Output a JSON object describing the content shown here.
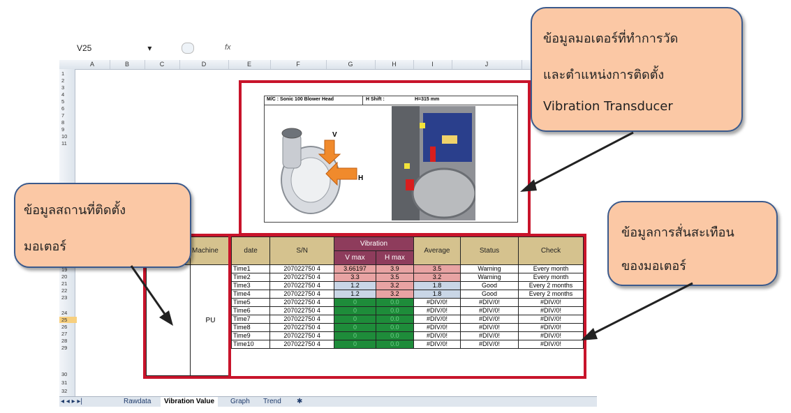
{
  "excel": {
    "name_box": "V25",
    "fx": "fx",
    "columns": [
      "A",
      "B",
      "C",
      "D",
      "E",
      "F",
      "G",
      "H",
      "I",
      "J"
    ],
    "rows": [
      "1",
      "2",
      "3",
      "4",
      "5",
      "6",
      "7",
      "8",
      "9",
      "10",
      "11",
      "19",
      "20",
      "21",
      "22",
      "23",
      "24",
      "25",
      "26",
      "27",
      "28",
      "29",
      "30",
      "31",
      "32"
    ],
    "selected_row": "25",
    "tabs": {
      "nav": "◂ ◂ ▸ ▸|",
      "rawdata": "Rawdata",
      "vibration_value": "Vibration Value",
      "graph": "Graph",
      "trend": "Trend"
    }
  },
  "picture": {
    "machine_label": "M/C : Sonic 100 Blower Head",
    "shift_label": "H Shift :",
    "shift_value": "H=315 mm",
    "v_marker": "V",
    "h_marker": "H"
  },
  "location_table": {
    "headers": [
      "Machine"
    ],
    "machine": "PU"
  },
  "vibration_table": {
    "headers": {
      "date": "date",
      "sn": "S/N",
      "vibration": "Vibration",
      "vmax": "V max",
      "hmax": "H max",
      "average": "Average",
      "status": "Status",
      "check": "Check"
    },
    "rows": [
      {
        "date": "Time1",
        "sn": "207022750 4",
        "v": "3.66197",
        "h": "3.9",
        "avg": "3.5",
        "status": "Warning",
        "check": "Every month"
      },
      {
        "date": "Time2",
        "sn": "207022750 4",
        "v": "3.3",
        "h": "3.5",
        "avg": "3.2",
        "status": "Warning",
        "check": "Every month"
      },
      {
        "date": "Time3",
        "sn": "207022750 4",
        "v": "1.2",
        "h": "3.2",
        "avg": "1.8",
        "status": "Good",
        "check": "Every 2 months"
      },
      {
        "date": "Time4",
        "sn": "207022750 4",
        "v": "1.2",
        "h": "3.2",
        "avg": "1.8",
        "status": "Good",
        "check": "Every 2 months"
      },
      {
        "date": "Time5",
        "sn": "207022750 4",
        "v": "0",
        "h": "0.0",
        "avg": "#DIV/0!",
        "status": "#DIV/0!",
        "check": "#DIV/0!"
      },
      {
        "date": "Time6",
        "sn": "207022750 4",
        "v": "0",
        "h": "0.0",
        "avg": "#DIV/0!",
        "status": "#DIV/0!",
        "check": "#DIV/0!"
      },
      {
        "date": "Time7",
        "sn": "207022750 4",
        "v": "0",
        "h": "0.0",
        "avg": "#DIV/0!",
        "status": "#DIV/0!",
        "check": "#DIV/0!"
      },
      {
        "date": "Time8",
        "sn": "207022750 4",
        "v": "0",
        "h": "0.0",
        "avg": "#DIV/0!",
        "status": "#DIV/0!",
        "check": "#DIV/0!"
      },
      {
        "date": "Time9",
        "sn": "207022750 4",
        "v": "0",
        "h": "0.0",
        "avg": "#DIV/0!",
        "status": "#DIV/0!",
        "check": "#DIV/0!"
      },
      {
        "date": "Time10",
        "sn": "207022750 4",
        "v": "0",
        "h": "0.0",
        "avg": "#DIV/0!",
        "status": "#DIV/0!",
        "check": "#DIV/0!"
      }
    ]
  },
  "callouts": {
    "motor": {
      "line1": "ข้อมูลมอเตอร์ที่ทำการวัด",
      "line2": "และตำแหน่งการติดตั้ง",
      "line3": "Vibration Transducer"
    },
    "location": {
      "line1": "ข้อมูลสถานที่ติดตั้ง",
      "line2": "มอเตอร์"
    },
    "vibration": {
      "line1": "ข้อมูลการสั่นสะเทือน",
      "line2": "ของมอเตอร์"
    }
  },
  "colors": {
    "frame_red": "#c8142b",
    "callout_fill": "#fbc8a5",
    "callout_border": "#3b5a8c",
    "header_tan": "#d5c28e",
    "vibration_header": "#8e3c5c",
    "warning_red": "#e8a3a3",
    "good_blue": "#c9d6e6",
    "zero_green": "#1e8c3a"
  }
}
